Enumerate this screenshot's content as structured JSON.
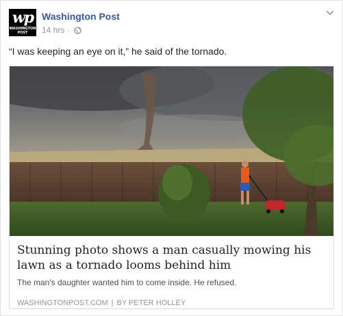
{
  "post": {
    "page_name": "Washington Post",
    "logo_mark": "wp",
    "logo_text_line1": "WASHINGTON",
    "logo_text_line2": "POST",
    "timestamp": "14 hrs",
    "meta_separator": "·",
    "privacy_icon": "globe-icon",
    "menu_icon": "chevron-down-icon",
    "text": "“I was keeping an eye on it,” he said of the tornado."
  },
  "link": {
    "image_icon": "tornado-lawn-photo",
    "title": "Stunning photo shows a man casually mowing his lawn as a tornado looms behind him",
    "description": "The man's daughter wanted him to come inside. He refused.",
    "domain": "WASHINGTONPOST.COM",
    "separator": "|",
    "author": "BY PETER HOLLEY"
  },
  "colors": {
    "link_blue": "#365899",
    "meta_gray": "#90949c",
    "text_dark": "#1d2129",
    "border": "#dddfe2"
  }
}
